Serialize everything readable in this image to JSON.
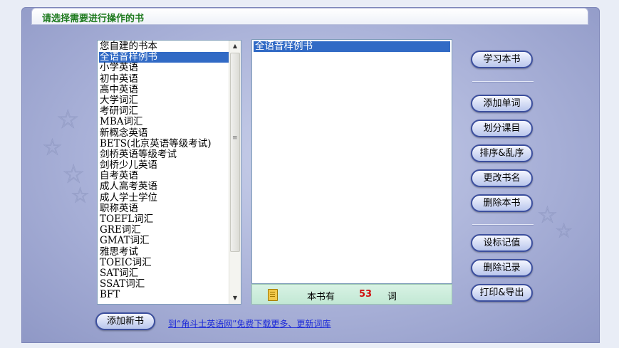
{
  "title": "请选择需要进行操作的书",
  "book_categories": [
    "您自建的书本",
    "全语音样例书",
    "小学英语",
    "初中英语",
    "高中英语",
    "大学词汇",
    "考研词汇",
    "MBA词汇",
    "新概念英语",
    "BETS(北京英语等级考试)",
    "剑桥英语等级考试",
    "剑桥少儿英语",
    "自考英语",
    "成人高考英语",
    "成人学士学位",
    "职称英语",
    "TOEFL词汇",
    "GRE词汇",
    "GMAT词汇",
    "雅思考试",
    "TOEIC词汇",
    "SAT词汇",
    "SSAT词汇",
    "BFT"
  ],
  "selected_category": "全语音样例书",
  "books": [
    "全语音样例书"
  ],
  "word_count": {
    "label": "本书有",
    "value": "53",
    "unit": "词"
  },
  "buttons": {
    "study": "学习本书",
    "add_words": "添加单词",
    "divide_lessons": "划分课目",
    "sort_shuffle": "排序&乱序",
    "rename": "更改书名",
    "delete_book": "删除本书",
    "set_mark": "设标记值",
    "delete_record": "删除记录",
    "print_export": "打印&导出",
    "add_book": "添加新书"
  },
  "download_link": "到“角斗士英语网”免费下载更多、更新词库",
  "colors": {
    "selection": "#316ac5",
    "title_text": "#1e7a1e",
    "count_value": "#d01010",
    "link": "#1c2ad8",
    "panel": "#a9b1d8"
  }
}
